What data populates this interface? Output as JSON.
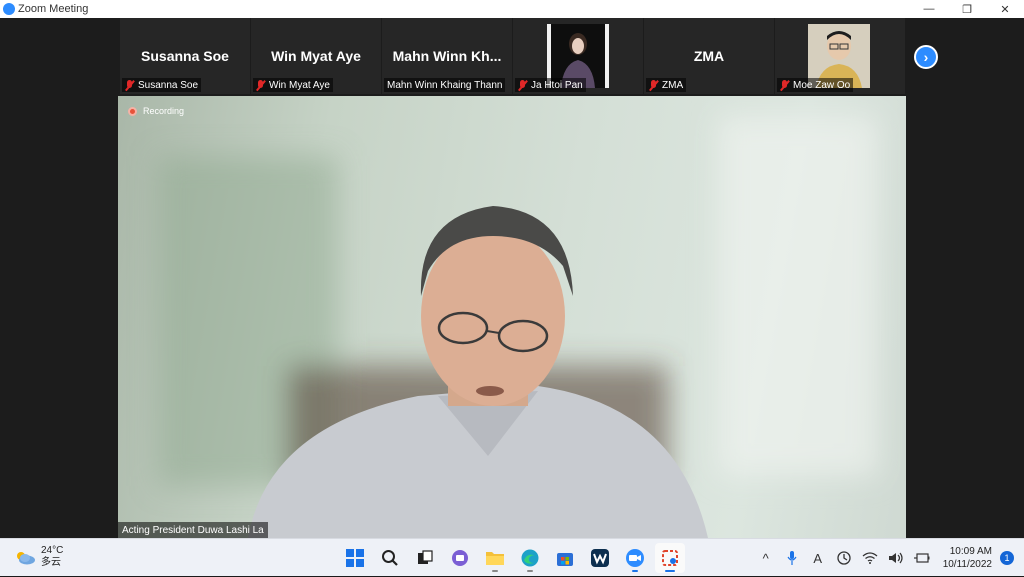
{
  "window": {
    "title": "Zoom Meeting",
    "controls": [
      "—",
      "❐",
      "✕"
    ]
  },
  "participants": [
    {
      "display": "Susanna Soe",
      "label": "Susanna Soe",
      "muted": true,
      "video": false
    },
    {
      "display": "Win Myat Aye",
      "label": "Win Myat Aye",
      "muted": true,
      "video": false
    },
    {
      "display": "Mahn Winn Kh...",
      "label": "Mahn Winn Khaing Thann",
      "muted": false,
      "video": false
    },
    {
      "display": "",
      "label": "Ja Htoi Pan",
      "muted": true,
      "video": true
    },
    {
      "display": "ZMA",
      "label": "ZMA",
      "muted": true,
      "video": false
    },
    {
      "display": "",
      "label": "Moe Zaw Oo",
      "muted": true,
      "video": true
    }
  ],
  "next_arrow": "›",
  "main": {
    "recording_label": "Recording",
    "speaker_name": "Acting President Duwa Lashi La"
  },
  "taskbar": {
    "weather": {
      "temp": "24°C",
      "condition": "多云"
    },
    "clock": {
      "time": "10:09 AM",
      "date": "10/11/2022"
    },
    "notification_count": "1",
    "ime": "A"
  },
  "colors": {
    "zoom_blue": "#2d8cff",
    "mute_red": "#e02828",
    "recording": "#e8533a"
  }
}
